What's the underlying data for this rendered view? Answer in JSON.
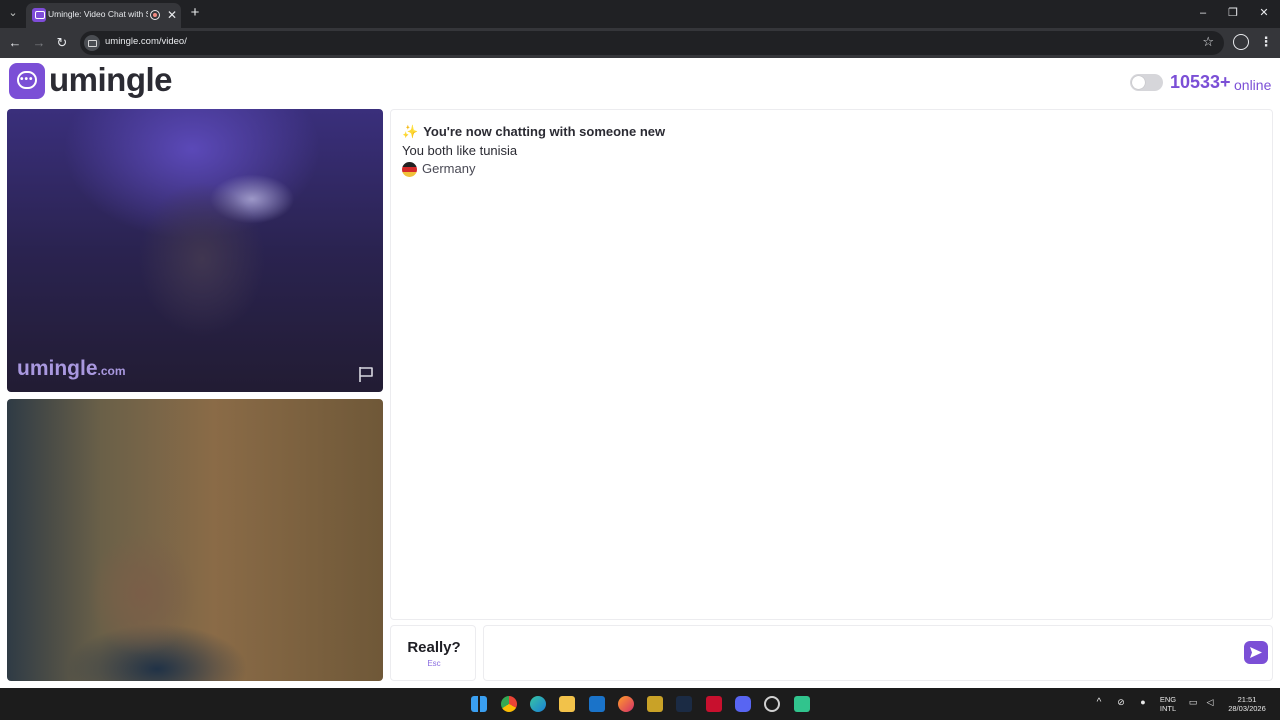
{
  "browser": {
    "tab_title": "Umingle: Video Chat with S",
    "url": "umingle.com/video/",
    "tab_close": "✕",
    "new_tab": "+",
    "window": {
      "minimize": "–",
      "restore": "❐",
      "close": "✕"
    }
  },
  "header": {
    "logo_text": "umingle",
    "online_count": "10533+",
    "online_label": "online"
  },
  "videos": {
    "watermark": "umingle",
    "watermark_tld": ".com"
  },
  "chat": {
    "system_title": "You're now chatting with someone new",
    "common_interest": "You both like tunisia",
    "country": "Germany",
    "stop_label": "Really?",
    "stop_hint": "Esc",
    "message_value": ""
  },
  "taskbar": {
    "lang_top": "ENG",
    "lang_bottom": "INTL",
    "time": "21:51",
    "date": "28/03/2026"
  },
  "colors": {
    "brand": "#7b4fd6",
    "text": "#2b2b33"
  }
}
